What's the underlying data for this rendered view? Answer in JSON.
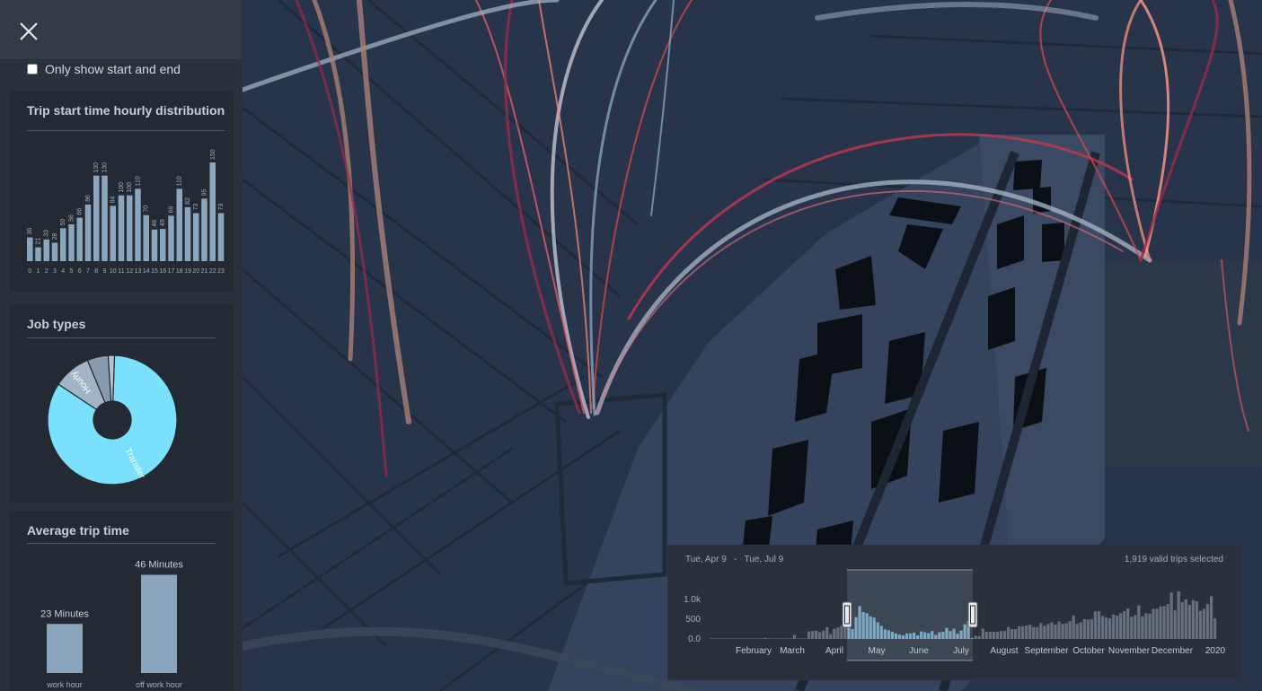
{
  "sidebar": {
    "only_start_end_label": "Only show start and end"
  },
  "hourly": {
    "title": "Trip start time hourly distribution",
    "chart_data": {
      "type": "bar",
      "categories": [
        "0",
        "1",
        "2",
        "3",
        "4",
        "5",
        "6",
        "7",
        "8",
        "9",
        "10",
        "11",
        "12",
        "13",
        "14",
        "15",
        "16",
        "17",
        "18",
        "19",
        "20",
        "21",
        "22",
        "23"
      ],
      "values": [
        36,
        21,
        33,
        28,
        50,
        56,
        66,
        86,
        130,
        130,
        84,
        100,
        100,
        110,
        70,
        48,
        49,
        69,
        110,
        82,
        73,
        95,
        150,
        73
      ],
      "ylim": [
        0,
        150
      ]
    }
  },
  "jobs": {
    "title": "Job types",
    "chart_data": {
      "type": "pie",
      "categories": [
        "Transfer",
        "Hourly",
        "",
        ""
      ],
      "values": [
        80,
        9,
        5,
        1.5
      ],
      "colors": [
        "#7ae0fb",
        "#a3b4c6",
        "#8a9aae",
        "#b6c3d2"
      ]
    }
  },
  "avg": {
    "title": "Average trip time",
    "chart_data": {
      "type": "bar",
      "categories": [
        "work hour",
        "off work hour"
      ],
      "values": [
        23,
        46
      ],
      "data_labels": [
        "23 Minutes",
        "46 Minutes"
      ]
    }
  },
  "timeline": {
    "range_start": "Tue, Apr 9",
    "range_sep": "-",
    "range_end": "Tue, Jul 9",
    "count": "1,919 valid trips selected",
    "chart_data": {
      "type": "bar",
      "y_ticks": [
        "1.0k",
        "500",
        "0.0"
      ],
      "ylim": [
        0,
        1200
      ],
      "x_labels": [
        "February",
        "March",
        "April",
        "May",
        "June",
        "July",
        "August",
        "September",
        "October",
        "November",
        "December",
        "2020"
      ],
      "values": [
        5,
        5,
        5,
        5,
        5,
        10,
        5,
        5,
        5,
        5,
        12,
        10,
        5,
        5,
        10,
        25,
        5,
        5,
        5,
        5,
        5,
        10,
        15,
        100,
        5,
        5,
        15,
        190,
        200,
        210,
        170,
        210,
        300,
        120,
        260,
        290,
        330,
        400,
        470,
        250,
        550,
        830,
        680,
        650,
        570,
        540,
        420,
        330,
        240,
        220,
        180,
        140,
        110,
        90,
        140,
        140,
        160,
        90,
        190,
        170,
        150,
        200,
        100,
        170,
        180,
        280,
        200,
        260,
        130,
        210,
        370,
        450,
        20,
        80,
        70,
        260,
        180,
        180,
        180,
        180,
        200,
        200,
        300,
        250,
        250,
        320,
        320,
        340,
        360,
        300,
        300,
        400,
        330,
        380,
        420,
        360,
        440,
        380,
        400,
        450,
        590,
        380,
        420,
        500,
        490,
        500,
        700,
        700,
        580,
        540,
        520,
        620,
        590,
        650,
        700,
        770,
        560,
        600,
        850,
        570,
        650,
        640,
        760,
        760,
        820,
        830,
        880,
        1170,
        720,
        1200,
        930,
        1000,
        860,
        980,
        950,
        710,
        760,
        880,
        1080,
        520
      ]
    }
  }
}
